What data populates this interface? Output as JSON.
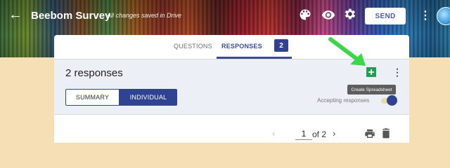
{
  "header": {
    "back_icon": "arrow-left-icon",
    "title": "Beebom Survey",
    "saved_status": "All changes saved in Drive",
    "send_label": "SEND",
    "icons": [
      "palette-icon",
      "eye-icon",
      "gear-icon",
      "more-vert-icon"
    ]
  },
  "tabs": {
    "questions_label": "QUESTIONS",
    "responses_label": "RESPONSES",
    "responses_count": "2"
  },
  "summary": {
    "responses_title": "2 responses",
    "tooltip": "Create Spreadsheet",
    "summary_label": "SUMMARY",
    "individual_label": "INDIVIDUAL",
    "accepting_label": "Accepting responses",
    "accepting_on": true
  },
  "pager": {
    "prev_glyph": "‹",
    "next_glyph": "›",
    "current_page": "1",
    "of_total": "of 2"
  },
  "colors": {
    "accent": "#2f4390",
    "sheet_green": "#1f9f55",
    "annotation_arrow": "#3cd64a",
    "background": "#f7dfb5"
  }
}
